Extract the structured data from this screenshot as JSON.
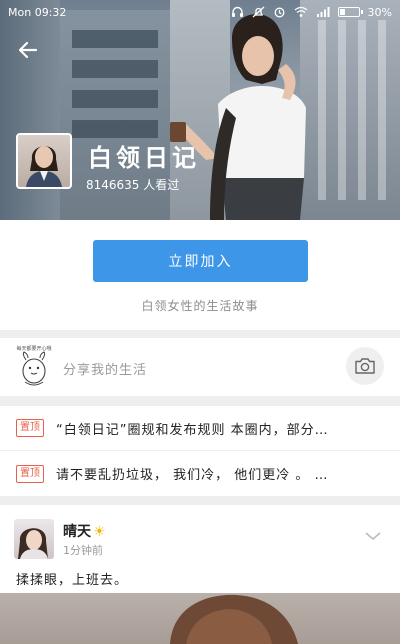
{
  "status_bar": {
    "time": "Mon 09:32",
    "battery": "30%",
    "battery_level": 0.3,
    "icons": [
      "headphones-icon",
      "mute-icon",
      "alarm-icon",
      "wifi-icon",
      "signal-icon",
      "battery-icon"
    ]
  },
  "header": {
    "back_icon": "back-arrow-icon",
    "title": "白领日记",
    "views": "8146635 人看过"
  },
  "join": {
    "button_label": "立即加入",
    "description": "白领女性的生活故事"
  },
  "share": {
    "placeholder": "分享我的生活",
    "avatar_caption": "每天都要开心哦",
    "camera_icon": "camera-icon"
  },
  "pinned": [
    {
      "badge": "置顶",
      "text": "“白领日记”圈规和发布规则 本圈内，部分…"
    },
    {
      "badge": "置顶",
      "text": "请不要乱扔垃圾， 我们冷， 他们更冷 。 …"
    }
  ],
  "post": {
    "author": "晴天",
    "author_emoji": "☀",
    "time": "1分钟前",
    "body": "揉揉眼，上班去。",
    "menu_icon": "chevron-down-icon"
  },
  "colors": {
    "accent": "#3d96e8",
    "pin_badge": "#e8624a",
    "secondary_text": "#9a9a9a"
  }
}
